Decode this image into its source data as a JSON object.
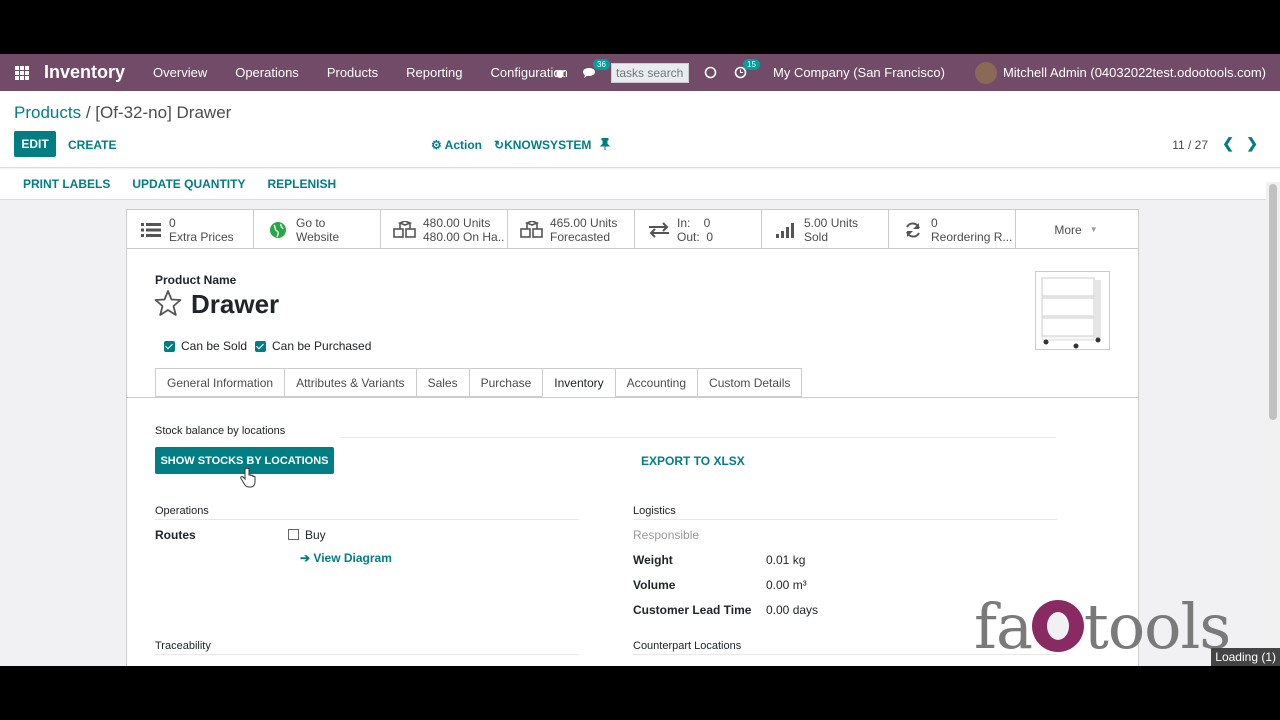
{
  "navbar": {
    "app_name": "Inventory",
    "menus": [
      "Overview",
      "Operations",
      "Products",
      "Reporting",
      "Configuration"
    ],
    "chat_count": "36",
    "search_placeholder": "tasks search",
    "activity_count": "15",
    "company": "My Company (San Francisco)",
    "user": "Mitchell Admin (04032022test.odootools.com)"
  },
  "breadcrumb": {
    "parent": "Products",
    "sep": " / ",
    "current": "[Of-32-no] Drawer"
  },
  "control": {
    "edit": "EDIT",
    "create": "CREATE",
    "action": "Action",
    "knowsystem": "KNOWSYSTEM",
    "pager": "11 / 27"
  },
  "status_buttons": [
    "PRINT LABELS",
    "UPDATE QUANTITY",
    "REPLENISH"
  ],
  "smart_buttons": [
    {
      "l1": "0",
      "l2": "Extra Prices",
      "icon": "list-icon"
    },
    {
      "l1": "Go to",
      "l2": "Website",
      "icon": "globe-icon"
    },
    {
      "l1": "480.00 Units",
      "l2": "480.00 On Ha...",
      "icon": "cubes-icon"
    },
    {
      "l1": "465.00 Units",
      "l2": "Forecasted",
      "icon": "cubes-icon"
    },
    {
      "l1": "In:    0",
      "l2": "Out:  0",
      "icon": "exchange-icon"
    },
    {
      "l1": "5.00 Units",
      "l2": "Sold",
      "icon": "signal-icon"
    },
    {
      "l1": "0",
      "l2": "Reordering R...",
      "icon": "refresh-icon"
    }
  ],
  "more_label": "More",
  "product": {
    "name_label": "Product Name",
    "name": "Drawer",
    "can_be_sold": "Can be Sold",
    "can_be_purchased": "Can be Purchased"
  },
  "tabs": [
    "General Information",
    "Attributes & Variants",
    "Sales",
    "Purchase",
    "Inventory",
    "Accounting",
    "Custom Details"
  ],
  "active_tab": "Inventory",
  "inventory": {
    "stock_balance_label": "Stock balance by locations",
    "show_stocks": "SHOW STOCKS BY LOCATIONS",
    "export_xlsx": "EXPORT TO XLSX",
    "operations_label": "Operations",
    "routes_label": "Routes",
    "route_buy": "Buy",
    "view_diagram": "View Diagram",
    "logistics_label": "Logistics",
    "responsible_label": "Responsible",
    "weight_label": "Weight",
    "weight_value": "0.01 kg",
    "volume_label": "Volume",
    "volume_value": "0.00 m³",
    "lead_time_label": "Customer Lead Time",
    "lead_time_value": "0.00 days",
    "traceability_label": "Traceability",
    "counterpart_label": "Counterpart Locations"
  },
  "watermark": "faOtools",
  "loading": "Loading (1)"
}
